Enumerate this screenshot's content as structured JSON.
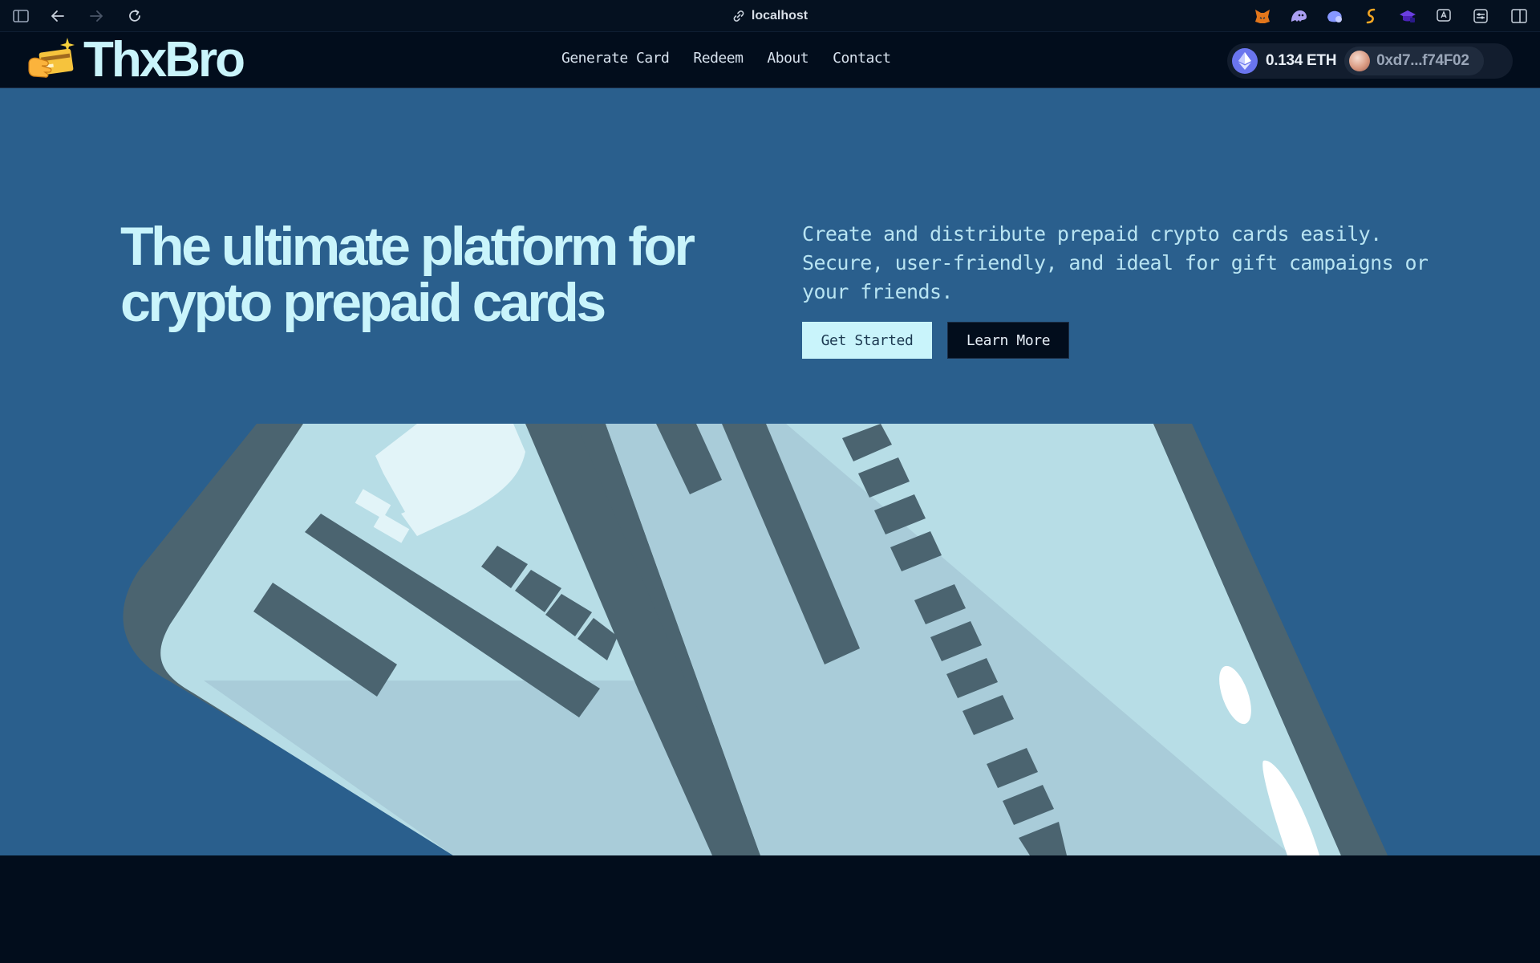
{
  "browser": {
    "url": "localhost",
    "extensions": [
      "metamask-icon",
      "ghost-wallet-icon",
      "rabby-icon",
      "swap-icon",
      "graduation-icon",
      "translate-icon",
      "settings-toggle-icon",
      "sidebar-icon"
    ]
  },
  "site": {
    "logo_text": "ThxBro",
    "logo_emoji": "🫰",
    "nav": {
      "items": [
        {
          "label": "Generate Card"
        },
        {
          "label": "Redeem"
        },
        {
          "label": "About"
        },
        {
          "label": "Contact"
        }
      ]
    },
    "wallet": {
      "balance": "0.134 ETH",
      "address": "0xd7...f74F02"
    }
  },
  "hero": {
    "headline": "The ultimate platform for crypto prepaid cards",
    "tagline": "Create and distribute prepaid crypto cards easily. Secure, user-friendly, and ideal for gift campaigns or your friends.",
    "primary_button": "Get Started",
    "secondary_button": "Learn More"
  },
  "colors": {
    "hero_bg": "#2a5f8d",
    "accent": "#c9f4fb",
    "dark": "#020d1c",
    "card_light": "#b7dde6",
    "card_stroke": "#4b6470"
  }
}
